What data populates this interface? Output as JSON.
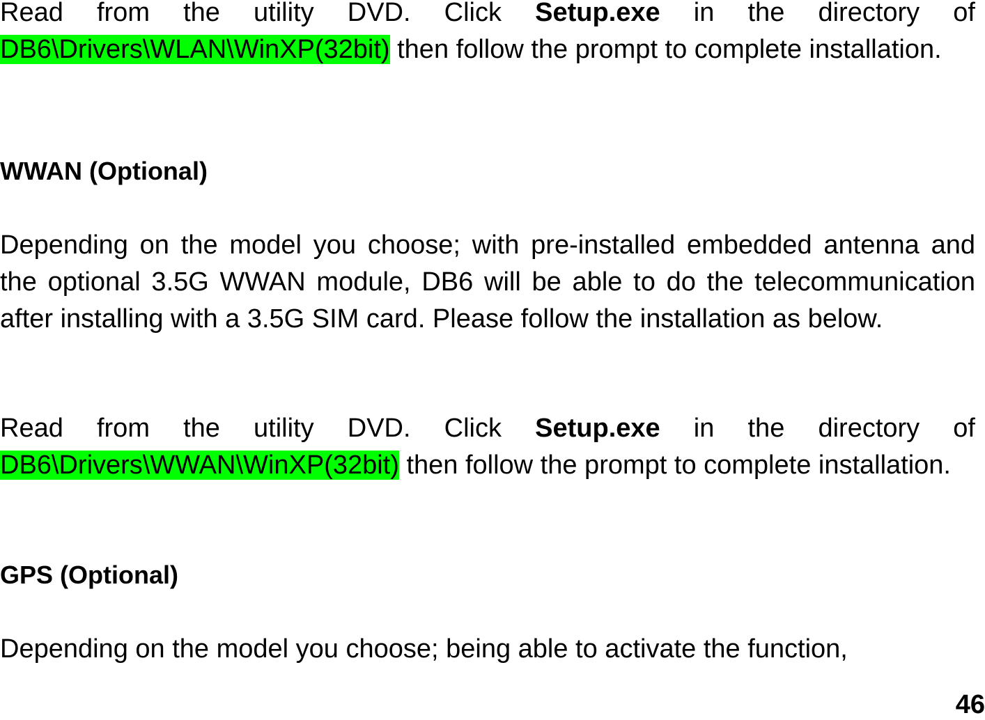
{
  "document": {
    "sections": [
      {
        "wlan_instruction": {
          "prefix": "Read from the utility DVD. Click ",
          "file": "Setup.exe",
          "middle": " in the directory of ",
          "path": "DB6\\Drivers\\WLAN\\WinXP(32bit)",
          "suffix": " then follow the prompt to complete installation."
        }
      }
    ],
    "wwan": {
      "heading": "WWAN (Optional)",
      "description": "Depending on the model you choose; with pre-installed embedded antenna and the optional 3.5G WWAN module, DB6 will be able to do the telecommunication after installing with a 3.5G SIM card. Please follow the installation as below.",
      "instruction": {
        "prefix": "Read from the utility DVD. Click ",
        "file": "Setup.exe",
        "middle": " in the directory of ",
        "path": "DB6\\Drivers\\WWAN\\WinXP(32bit)",
        "suffix": " then follow the prompt to complete installation."
      }
    },
    "gps": {
      "heading": "GPS (Optional)",
      "description": "Depending on the model you choose; being able to activate the function,"
    },
    "page_number": "46",
    "highlight_color": "#00ff00"
  }
}
